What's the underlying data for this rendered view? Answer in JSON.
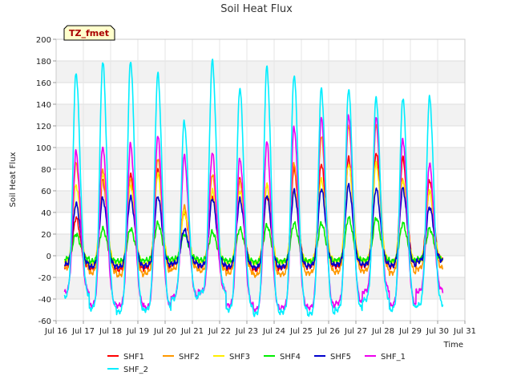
{
  "chart_data": {
    "type": "line",
    "title": "Soil Heat Flux",
    "xlabel": "Time",
    "ylabel": "Soil Heat Flux",
    "badge": "TZ_fmet",
    "ylim": [
      -60,
      200
    ],
    "xlim": [
      16,
      31
    ],
    "y_ticks": [
      -60,
      -40,
      -20,
      0,
      20,
      40,
      60,
      80,
      100,
      120,
      140,
      160,
      180,
      200
    ],
    "x_ticks": [
      16,
      17,
      18,
      19,
      20,
      21,
      22,
      23,
      24,
      25,
      26,
      27,
      28,
      29,
      30,
      31
    ],
    "x_tick_labels": [
      "Jul 16",
      "Jul 17",
      "Jul 18",
      "Jul 19",
      "Jul 20",
      "Jul 21",
      "Jul 22",
      "Jul 23",
      "Jul 24",
      "Jul 25",
      "Jul 26",
      "Jul 27",
      "Jul 28",
      "Jul 29",
      "Jul 30",
      "Jul 31"
    ],
    "grid": true,
    "legend_position": "bottom",
    "day_peak_times": [
      16.73,
      17.71,
      18.73,
      19.73,
      20.7,
      21.73,
      22.74,
      23.73,
      24.73,
      25.73,
      26.73,
      27.74,
      28.72,
      29.7
    ],
    "series": [
      {
        "name": "SHF1",
        "color": "#ff0000",
        "peaks": [
          35,
          70,
          75,
          80,
          40,
          55,
          70,
          55,
          80,
          85,
          90,
          95,
          90,
          70
        ],
        "minima": [
          -10,
          -12,
          -13,
          -11,
          -8,
          -10,
          -12,
          -13,
          -11,
          -10,
          -10,
          -9,
          -10,
          -5
        ]
      },
      {
        "name": "SHF2",
        "color": "#ff9900",
        "peaks": [
          85,
          80,
          70,
          90,
          45,
          75,
          70,
          65,
          85,
          110,
          120,
          120,
          70,
          60
        ],
        "minima": [
          -12,
          -16,
          -18,
          -16,
          -12,
          -14,
          -16,
          -18,
          -17,
          -16,
          -15,
          -14,
          -16,
          -12
        ]
      },
      {
        "name": "SHF3",
        "color": "#ffee00",
        "peaks": [
          65,
          75,
          65,
          75,
          40,
          60,
          60,
          65,
          60,
          70,
          85,
          85,
          70,
          60
        ],
        "minima": [
          -6,
          -8,
          -8,
          -7,
          -5,
          -6,
          -7,
          -7,
          -6,
          -5,
          -5,
          -5,
          -6,
          -4
        ]
      },
      {
        "name": "SHF4",
        "color": "#00ee00",
        "peaks": [
          20,
          25,
          25,
          30,
          20,
          22,
          25,
          28,
          30,
          30,
          35,
          35,
          30,
          25
        ],
        "minima": [
          -3,
          -5,
          -5,
          -4,
          -3,
          -4,
          -5,
          -6,
          -5,
          -5,
          -4,
          -4,
          -5,
          -3
        ]
      },
      {
        "name": "SHF5",
        "color": "#0000cc",
        "peaks": [
          48,
          53,
          54,
          55,
          24,
          53,
          52,
          56,
          60,
          62,
          65,
          62,
          62,
          45
        ],
        "minima": [
          -8,
          -10,
          -10,
          -9,
          -7,
          -9,
          -10,
          -11,
          -10,
          -9,
          -8,
          -8,
          -9,
          -5
        ]
      },
      {
        "name": "SHF_1",
        "color": "#ee00ee",
        "peaks": [
          96,
          101,
          103,
          111,
          92,
          95,
          90,
          105,
          119,
          127,
          130,
          127,
          108,
          85
        ],
        "minima": [
          -34,
          -46,
          -46,
          -48,
          -38,
          -33,
          -46,
          -50,
          -48,
          -48,
          -44,
          -33,
          -46,
          -33
        ]
      },
      {
        "name": "SHF_2",
        "color": "#00eeff",
        "peaks": [
          169,
          179,
          180,
          168,
          124,
          180,
          155,
          174,
          167,
          154,
          154,
          146,
          146,
          146
        ],
        "minima": [
          -38,
          -49,
          -52,
          -50,
          -40,
          -34,
          -50,
          -54,
          -52,
          -54,
          -50,
          -41,
          -50,
          -46
        ]
      }
    ]
  }
}
